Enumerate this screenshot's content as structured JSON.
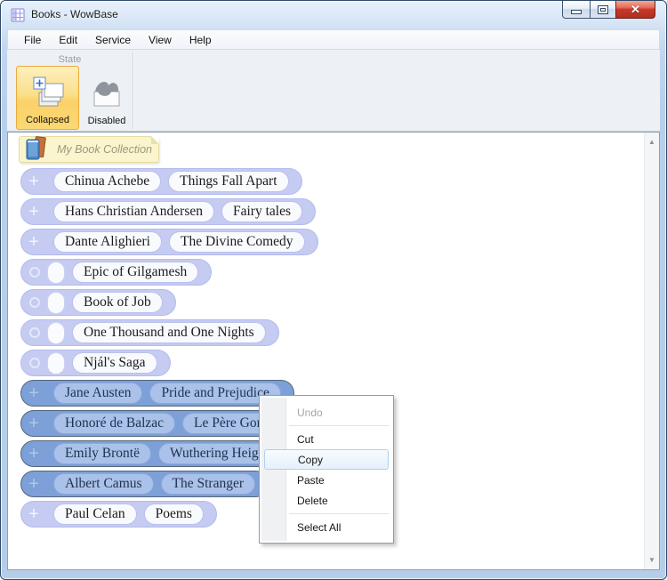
{
  "window": {
    "title": "Books - WowBase"
  },
  "menu_bar": {
    "items": [
      "File",
      "Edit",
      "Service",
      "View",
      "Help"
    ]
  },
  "ribbon": {
    "group_label": "State",
    "buttons": [
      {
        "label": "Collapsed",
        "active": true,
        "icon": "collapsed-cards-plus-icon"
      },
      {
        "label": "Disabled",
        "active": false,
        "icon": "disabled-gray-card-icon"
      }
    ]
  },
  "collection": {
    "header": "My Book Collection",
    "icon": "books-icon"
  },
  "books": [
    {
      "author": "Chinua Achebe",
      "title": "Things Fall Apart",
      "selected": false
    },
    {
      "author": "Hans Christian Andersen",
      "title": "Fairy tales",
      "selected": false
    },
    {
      "author": "Dante Alighieri",
      "title": "The Divine Comedy",
      "selected": false
    },
    {
      "author": null,
      "title": "Epic of Gilgamesh",
      "selected": false
    },
    {
      "author": null,
      "title": "Book of Job",
      "selected": false
    },
    {
      "author": null,
      "title": "One Thousand and One Nights",
      "selected": false
    },
    {
      "author": null,
      "title": "Njál's Saga",
      "selected": false
    },
    {
      "author": "Jane Austen",
      "title": "Pride and Prejudice",
      "selected": true
    },
    {
      "author": "Honoré de Balzac",
      "title": "Le Père Goriot",
      "selected": true
    },
    {
      "author": "Emily Brontë",
      "title": "Wuthering Heights",
      "selected": true
    },
    {
      "author": "Albert Camus",
      "title": "The Stranger",
      "selected": true
    },
    {
      "author": "Paul Celan",
      "title": "Poems",
      "selected": false
    }
  ],
  "context_menu": {
    "items": [
      {
        "label": "Undo",
        "disabled": true
      },
      {
        "label": "Cut",
        "disabled": false
      },
      {
        "label": "Copy",
        "disabled": false,
        "highlighted": true
      },
      {
        "label": "Paste",
        "disabled": false
      },
      {
        "label": "Delete",
        "disabled": false
      },
      {
        "label": "Select All",
        "disabled": false
      }
    ]
  },
  "glyphs": {
    "plus": "+",
    "close": "✕",
    "scroll_up": "▲",
    "scroll_down": "▼"
  },
  "colors": {
    "selection_blue": "#7ca0d7",
    "row_lavender": "#c5cbf1",
    "pill_white": "#f9fafe",
    "active_button_orange": "#fbd169",
    "note_yellow": "#fbf5cd",
    "close_red": "#c6392a",
    "menu_highlight": "#e6f0fb"
  }
}
